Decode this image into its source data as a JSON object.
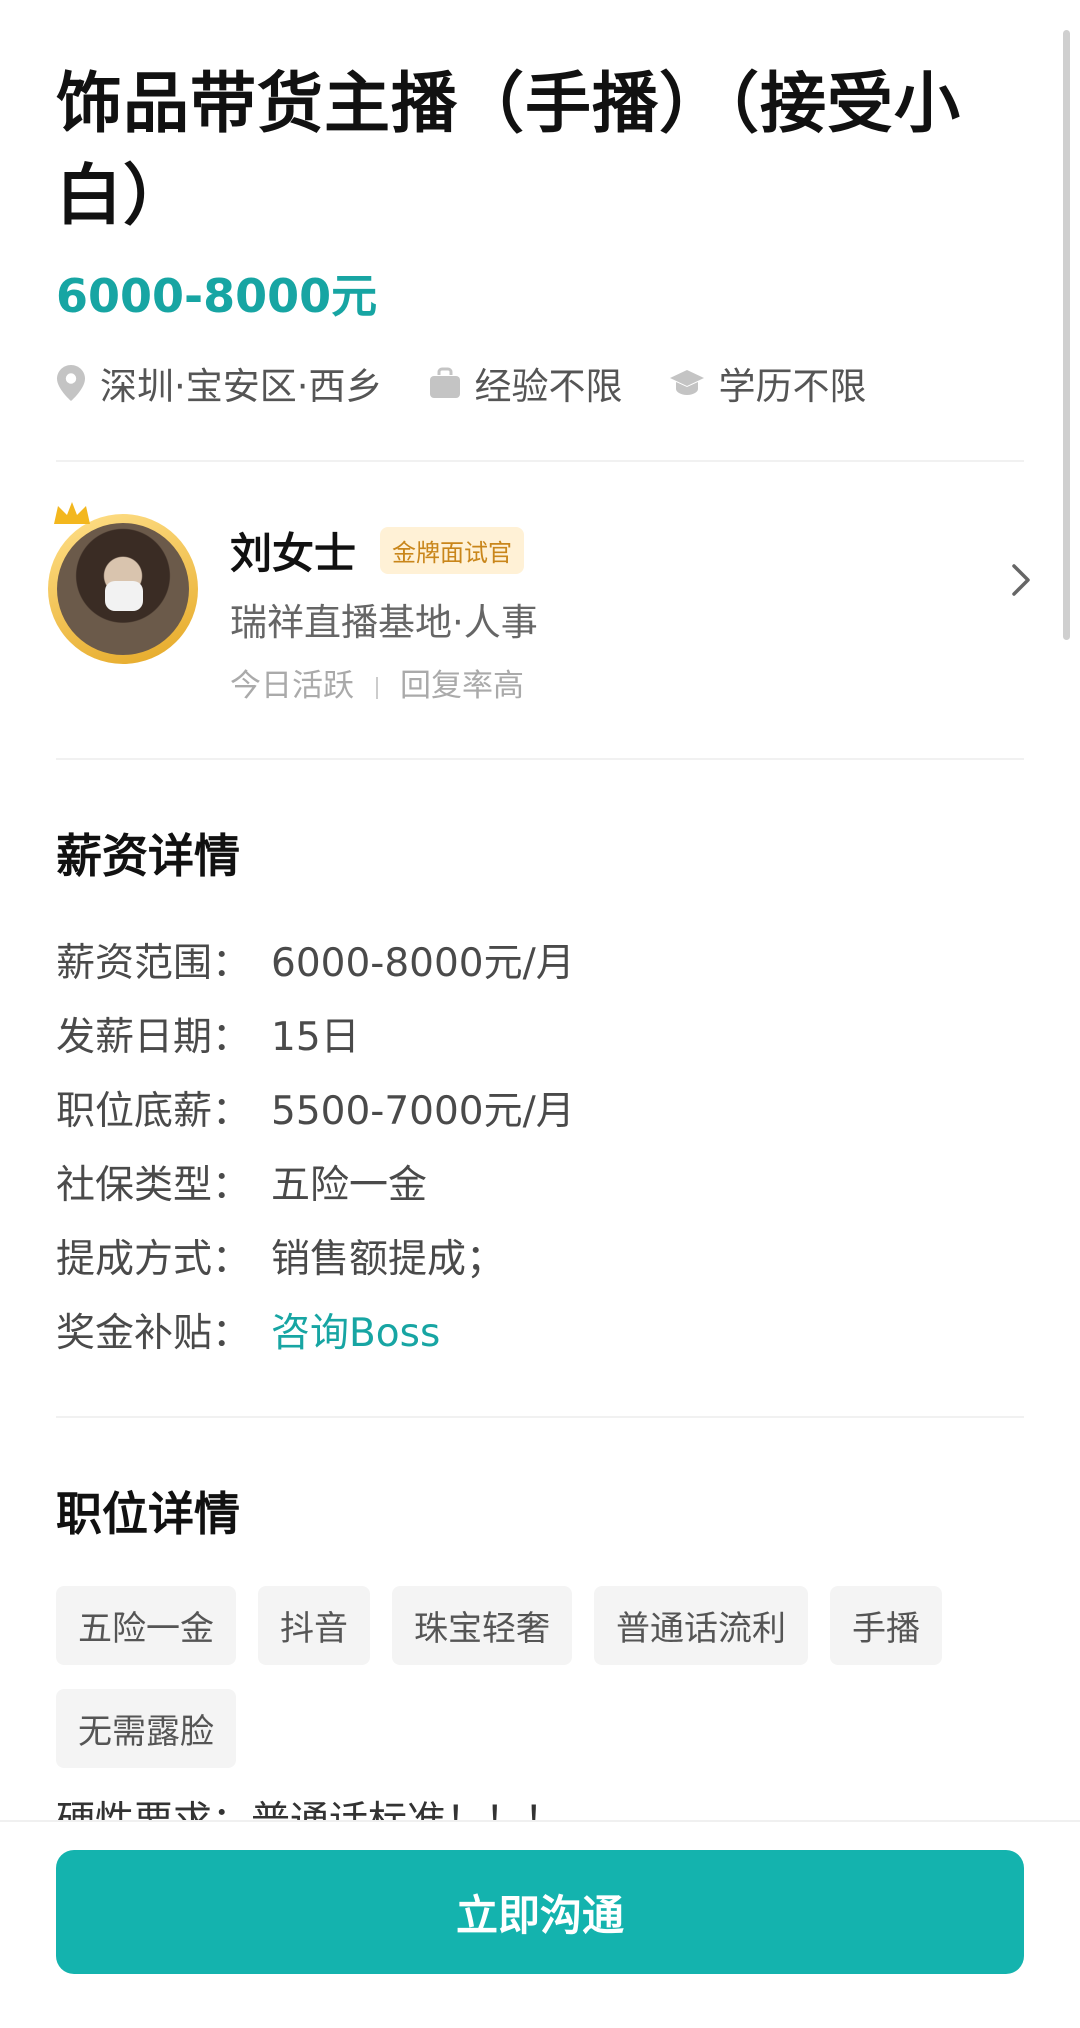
{
  "job": {
    "title": "饰品带货主播（手播）（接受小白）",
    "salary": "6000-8000元",
    "location": "深圳·宝安区·西乡",
    "experience": "经验不限",
    "education": "学历不限"
  },
  "recruiter": {
    "name": "刘女士",
    "badge": "金牌面试官",
    "company": "瑞祥直播基地·人事",
    "active": "今日活跃",
    "reply": "回复率高"
  },
  "salary_details": {
    "heading": "薪资详情",
    "rows": [
      {
        "k": "薪资范围：",
        "v": "6000-8000元/月"
      },
      {
        "k": "发薪日期：",
        "v": "15日"
      },
      {
        "k": "职位底薪：",
        "v": "5500-7000元/月"
      },
      {
        "k": "社保类型：",
        "v": "五险一金"
      },
      {
        "k": "提成方式：",
        "v": "销售额提成；"
      },
      {
        "k": "奖金补贴：",
        "v": "咨询Boss"
      }
    ]
  },
  "job_details": {
    "heading": "职位详情",
    "tags": [
      "五险一金",
      "抖音",
      "珠宝轻奢",
      "普通话流利",
      "手播",
      "无需露脸"
    ],
    "partial_line": "硬性要求：普通话标准！！！"
  },
  "cta": {
    "label": "立即沟通"
  },
  "colors": {
    "accent": "#17a5a3",
    "button": "#14b3ae",
    "badge_bg": "#fff1d6",
    "badge_text": "#c9861b"
  },
  "icons": [
    "location-icon",
    "briefcase-icon",
    "graduation-cap-icon",
    "crown-icon",
    "chevron-right-icon"
  ]
}
